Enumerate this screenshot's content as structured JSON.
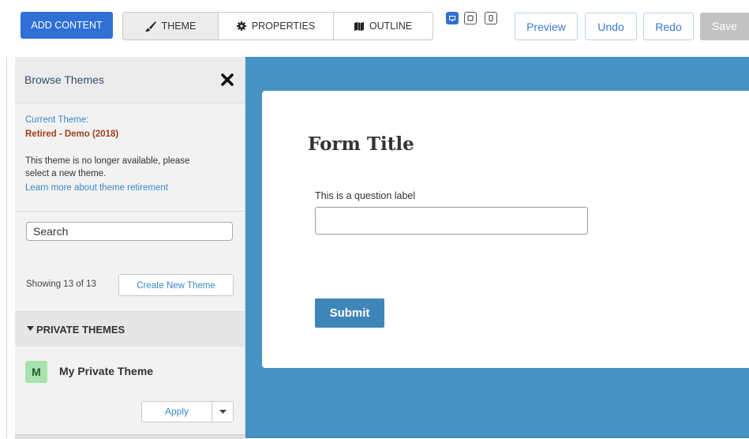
{
  "toolbar": {
    "add_content": "ADD CONTENT",
    "tabs": [
      {
        "label": "THEME",
        "icon": "brush-icon",
        "active": true
      },
      {
        "label": "PROPERTIES",
        "icon": "gear-icon",
        "active": false
      },
      {
        "label": "OUTLINE",
        "icon": "map-icon",
        "active": false
      }
    ],
    "devices": [
      {
        "icon": "desktop-icon",
        "active": true
      },
      {
        "icon": "tablet-icon",
        "active": false
      },
      {
        "icon": "phone-icon",
        "active": false
      }
    ],
    "preview": "Preview",
    "undo": "Undo",
    "redo": "Redo",
    "save": "Save"
  },
  "sidebar": {
    "title": "Browse Themes",
    "current_label": "Current Theme:",
    "current_name": "Retired - Demo (2018)",
    "retired_note": "This theme is no longer available, please select a new theme.",
    "learn_link": "Learn more about theme retirement",
    "search_value": "Search",
    "showing": "Showing 13 of 13",
    "create_button": "Create New Theme",
    "private_header": "PRIVATE THEMES",
    "themes": [
      {
        "initial": "M",
        "name": "My Private Theme",
        "apply": "Apply"
      }
    ]
  },
  "form": {
    "title": "Form Title",
    "question_label": "This is a question label",
    "question_value": "",
    "submit": "Submit"
  },
  "colors": {
    "accent": "#2f6fd6",
    "canvas_bg": "#4592c3",
    "submit_bg": "#3f86b8",
    "link": "#3a88c8",
    "retired_theme": "#a0401c",
    "avatar_bg": "#a8e2ad"
  }
}
